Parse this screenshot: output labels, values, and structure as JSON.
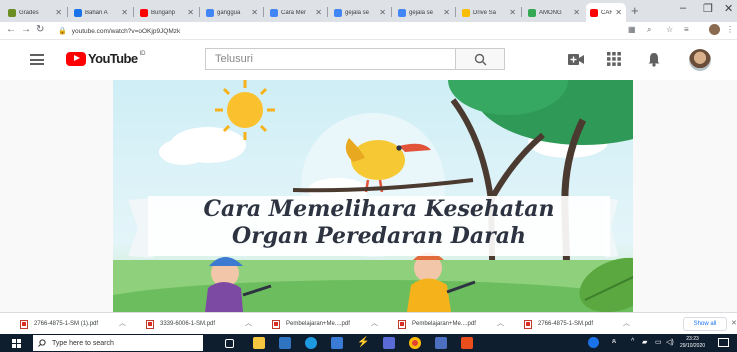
{
  "browser": {
    "tabs": [
      {
        "label": "Grades",
        "favicon_color": "#6b8e23"
      },
      {
        "label": "Bahan A",
        "favicon_color": "#1a73e8"
      },
      {
        "label": "Bunganp",
        "favicon_color": "#ff0000"
      },
      {
        "label": "ganggua",
        "favicon_color": "#4285f4"
      },
      {
        "label": "Cara Mer",
        "favicon_color": "#4285f4"
      },
      {
        "label": "gejala se",
        "favicon_color": "#4285f4"
      },
      {
        "label": "gejala se",
        "favicon_color": "#4285f4"
      },
      {
        "label": "Drive Sa",
        "favicon_color": "#fbbc04"
      },
      {
        "label": "AMONG",
        "favicon_color": "#34a853"
      },
      {
        "label": "CAR",
        "favicon_color": "#ff0000"
      }
    ],
    "new_tab_label": "+",
    "url": "youtube.com/watch?v=oOKjp9JQMzk"
  },
  "youtube": {
    "logo_text": "YouTube",
    "region": "ID",
    "search_placeholder": "Telusuri"
  },
  "video": {
    "title_line1": "Cara Memelihara Kesehatan",
    "title_line2": "Organ Peredaran Darah"
  },
  "downloads": {
    "items": [
      {
        "name": "2766-4875-1-SM (1).pdf"
      },
      {
        "name": "3339-6006-1-SM.pdf"
      },
      {
        "name": "Pembelajaran+Me....pdf"
      },
      {
        "name": "Pembelajaran+Me....pdf"
      },
      {
        "name": "2766-4875-1-SM.pdf"
      }
    ],
    "show_all": "Show all"
  },
  "taskbar": {
    "search_placeholder": "Type here to search",
    "time": "23:23",
    "date": "29/10/2020"
  },
  "colors": {
    "youtube_red": "#ff0000",
    "taskbar_bg": "#0f1e2f",
    "link_blue": "#1a73e8"
  }
}
